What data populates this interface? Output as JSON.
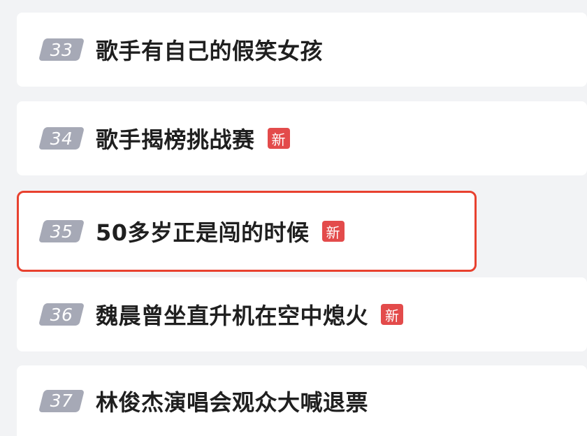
{
  "hot_list": {
    "items": [
      {
        "rank": "33",
        "title": "歌手有自己的假笑女孩",
        "badge": ""
      },
      {
        "rank": "34",
        "title": "歌手揭榜挑战赛",
        "badge": "新"
      },
      {
        "rank": "35",
        "title": "50多岁正是闯的时候",
        "badge": "新"
      },
      {
        "rank": "36",
        "title": "魏晨曾坐直升机在空中熄火",
        "badge": "新"
      },
      {
        "rank": "37",
        "title": "林俊杰演唱会观众大喊退票",
        "badge": ""
      }
    ]
  },
  "colors": {
    "rank_badge": "#a6a9b6",
    "new_badge": "#e34b4b",
    "highlight_border": "#e8412f"
  },
  "icons": {
    "new_badge": "new-tag-icon"
  }
}
